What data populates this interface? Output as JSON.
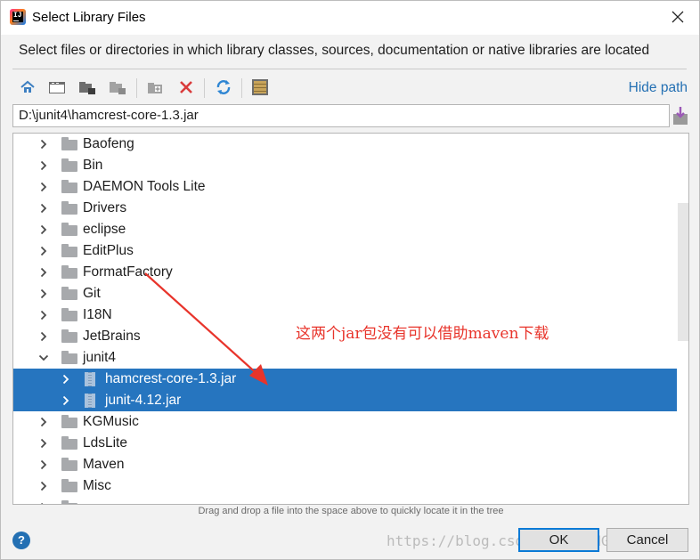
{
  "window": {
    "title": "Select Library Files",
    "instruction": "Select files or directories in which library classes, sources, documentation or native libraries are located"
  },
  "toolbar": {
    "buttons": [
      "home-icon",
      "desktop-icon",
      "project-icon",
      "module-icon",
      "new-folder-icon",
      "delete-icon",
      "refresh-icon",
      "show-hidden-icon"
    ],
    "hide_path": "Hide path"
  },
  "path": {
    "value": "D:\\junit4\\hamcrest-core-1.3.jar"
  },
  "tree": {
    "items": [
      {
        "label": "Baofeng",
        "type": "folder",
        "depth": 0,
        "expanded": false,
        "selected": false
      },
      {
        "label": "Bin",
        "type": "folder",
        "depth": 0,
        "expanded": false,
        "selected": false
      },
      {
        "label": "DAEMON Tools Lite",
        "type": "folder",
        "depth": 0,
        "expanded": false,
        "selected": false
      },
      {
        "label": "Drivers",
        "type": "folder",
        "depth": 0,
        "expanded": false,
        "selected": false
      },
      {
        "label": "eclipse",
        "type": "folder",
        "depth": 0,
        "expanded": false,
        "selected": false
      },
      {
        "label": "EditPlus",
        "type": "folder",
        "depth": 0,
        "expanded": false,
        "selected": false
      },
      {
        "label": "FormatFactory",
        "type": "folder",
        "depth": 0,
        "expanded": false,
        "selected": false
      },
      {
        "label": "Git",
        "type": "folder",
        "depth": 0,
        "expanded": false,
        "selected": false
      },
      {
        "label": "I18N",
        "type": "folder",
        "depth": 0,
        "expanded": false,
        "selected": false
      },
      {
        "label": "JetBrains",
        "type": "folder",
        "depth": 0,
        "expanded": false,
        "selected": false
      },
      {
        "label": "junit4",
        "type": "folder",
        "depth": 0,
        "expanded": true,
        "selected": false
      },
      {
        "label": "hamcrest-core-1.3.jar",
        "type": "jar",
        "depth": 1,
        "expanded": false,
        "selected": true
      },
      {
        "label": "junit-4.12.jar",
        "type": "jar",
        "depth": 1,
        "expanded": false,
        "selected": true
      },
      {
        "label": "KGMusic",
        "type": "folder",
        "depth": 0,
        "expanded": false,
        "selected": false
      },
      {
        "label": "LdsLite",
        "type": "folder",
        "depth": 0,
        "expanded": false,
        "selected": false
      },
      {
        "label": "Maven",
        "type": "folder",
        "depth": 0,
        "expanded": false,
        "selected": false
      },
      {
        "label": "Misc",
        "type": "folder",
        "depth": 0,
        "expanded": false,
        "selected": false
      },
      {
        "label": "",
        "type": "folder",
        "depth": 0,
        "expanded": false,
        "selected": false
      }
    ]
  },
  "annotation": {
    "text": "这两个jar包没有可以借助maven下载",
    "color": "#e8342b"
  },
  "hint": "Drag and drop a file into the space above to quickly locate it in the tree",
  "footer": {
    "help": "?",
    "ok": "OK",
    "cancel": "Cancel",
    "watermark": "https://blog.csdn.net/LONG 2094"
  },
  "colors": {
    "selection": "#2675bf",
    "link": "#2470b3",
    "default_button_border": "#0a7ad6"
  }
}
